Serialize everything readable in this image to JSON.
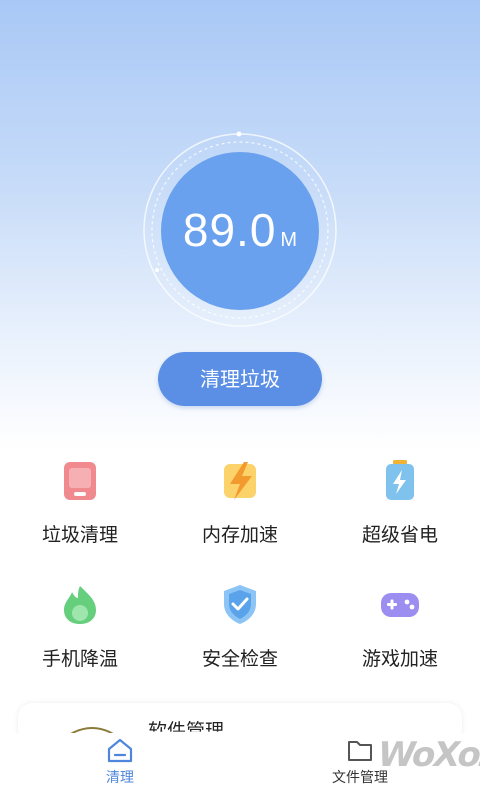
{
  "cleaner": {
    "size_value": "89.0",
    "size_unit": "M",
    "clean_button": "清理垃圾"
  },
  "features": [
    {
      "label": "垃圾清理",
      "icon": "phone-icon"
    },
    {
      "label": "内存加速",
      "icon": "lightning-icon"
    },
    {
      "label": "超级省电",
      "icon": "battery-icon"
    },
    {
      "label": "手机降温",
      "icon": "flame-icon"
    },
    {
      "label": "安全检查",
      "icon": "shield-icon"
    },
    {
      "label": "游戏加速",
      "icon": "gamepad-icon"
    }
  ],
  "card": {
    "title": "软件管理"
  },
  "tabbar": {
    "tabs": [
      {
        "label": "清理",
        "active": true,
        "icon": "home-icon"
      },
      {
        "label": "文件管理",
        "active": false,
        "icon": "folder-icon"
      }
    ]
  },
  "watermark": "WoXoZ",
  "colors": {
    "accent": "#5b8fe5",
    "circle": "#6aa1ef",
    "active_tab": "#4f86dc"
  }
}
